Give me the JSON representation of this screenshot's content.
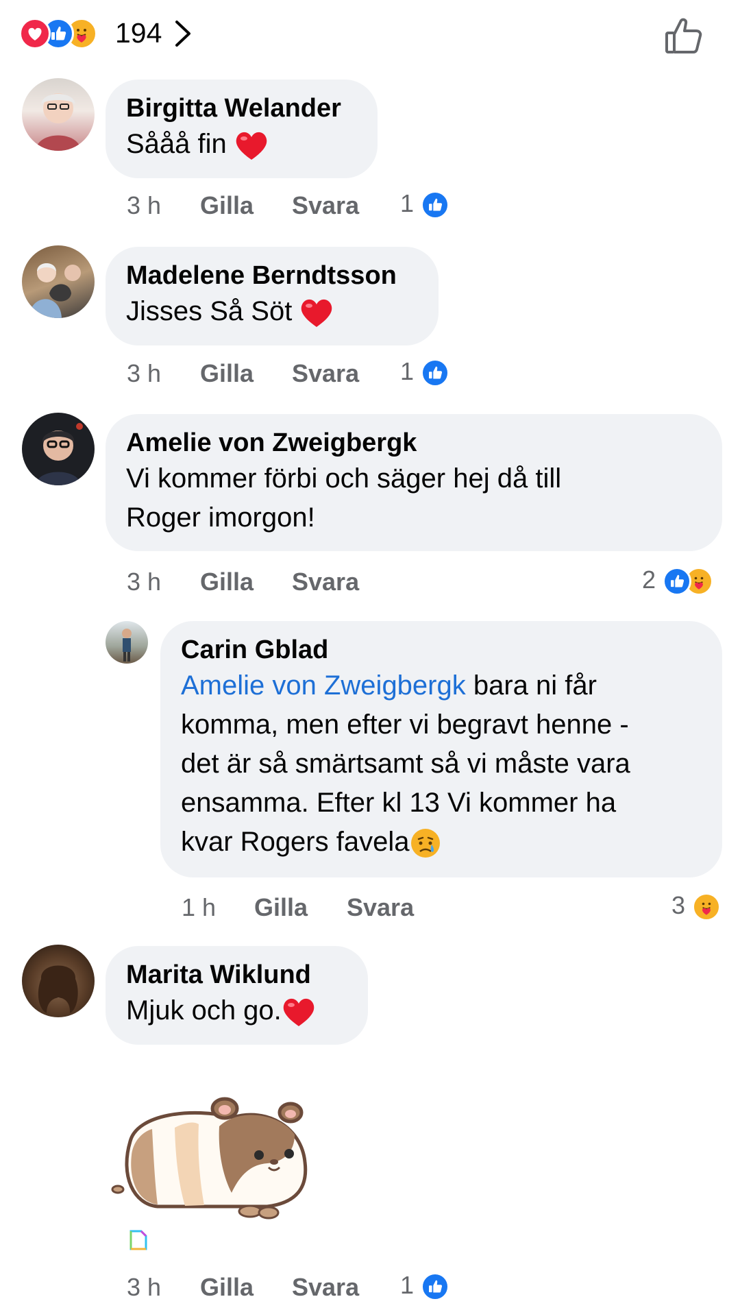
{
  "reactions_summary": {
    "count": "194"
  },
  "colors": {
    "like_blue": "#1877f2",
    "love_red": "#f0284a",
    "care_yellow": "#f7b125",
    "meta_gray": "#65676b",
    "bubble_bg": "#f0f2f5",
    "mention_blue": "#1d6fd6"
  },
  "actions": {
    "like": "Gilla",
    "reply": "Svara"
  },
  "comments": [
    {
      "author": "Birgitta Welander",
      "text": "Sååå fin",
      "time": "3 h",
      "reaction_count": "1"
    },
    {
      "author": "Madelene Berndtsson",
      "text": "Jisses Så Söt",
      "time": "3 h",
      "reaction_count": "1"
    },
    {
      "author": "Amelie von Zweigbergk",
      "text_line1": "Vi kommer förbi och säger hej då till",
      "text_line2": "Roger imorgon!",
      "time": "3 h",
      "reaction_count": "2"
    },
    {
      "author": "Carin Gblad",
      "mention": "Amelie von Zweigbergk",
      "line1_rest": " bara ni får",
      "line2": "komma, men efter vi begravt henne -",
      "line3": "det är så smärtsamt så vi måste vara",
      "line4": "ensamma. Efter kl 13 Vi kommer ha",
      "line5": "kvar Rogers favela",
      "time": "1 h",
      "reaction_count": "3"
    },
    {
      "author": "Marita Wiklund",
      "text": "Mjuk och go.",
      "time": "3 h",
      "reaction_count": "1"
    }
  ],
  "icons": [
    "love-reaction-icon",
    "like-reaction-icon",
    "care-reaction-icon",
    "chevron-right-icon",
    "thumbs-up-outline-icon",
    "heart-emoji",
    "crying-emoji",
    "guinea-pig-sticker",
    "sticker-indicator-icon"
  ]
}
